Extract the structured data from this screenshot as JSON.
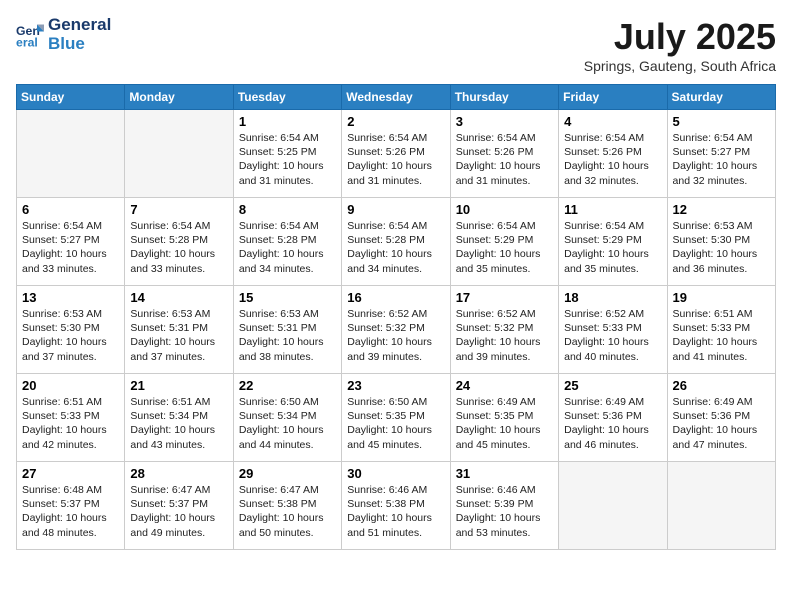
{
  "header": {
    "logo_line1": "General",
    "logo_line2": "Blue",
    "month_year": "July 2025",
    "location": "Springs, Gauteng, South Africa"
  },
  "days_of_week": [
    "Sunday",
    "Monday",
    "Tuesday",
    "Wednesday",
    "Thursday",
    "Friday",
    "Saturday"
  ],
  "weeks": [
    [
      {
        "day": "",
        "empty": true
      },
      {
        "day": "",
        "empty": true
      },
      {
        "day": "1",
        "sunrise": "6:54 AM",
        "sunset": "5:25 PM",
        "daylight": "10 hours and 31 minutes."
      },
      {
        "day": "2",
        "sunrise": "6:54 AM",
        "sunset": "5:26 PM",
        "daylight": "10 hours and 31 minutes."
      },
      {
        "day": "3",
        "sunrise": "6:54 AM",
        "sunset": "5:26 PM",
        "daylight": "10 hours and 31 minutes."
      },
      {
        "day": "4",
        "sunrise": "6:54 AM",
        "sunset": "5:26 PM",
        "daylight": "10 hours and 32 minutes."
      },
      {
        "day": "5",
        "sunrise": "6:54 AM",
        "sunset": "5:27 PM",
        "daylight": "10 hours and 32 minutes."
      }
    ],
    [
      {
        "day": "6",
        "sunrise": "6:54 AM",
        "sunset": "5:27 PM",
        "daylight": "10 hours and 33 minutes."
      },
      {
        "day": "7",
        "sunrise": "6:54 AM",
        "sunset": "5:28 PM",
        "daylight": "10 hours and 33 minutes."
      },
      {
        "day": "8",
        "sunrise": "6:54 AM",
        "sunset": "5:28 PM",
        "daylight": "10 hours and 34 minutes."
      },
      {
        "day": "9",
        "sunrise": "6:54 AM",
        "sunset": "5:28 PM",
        "daylight": "10 hours and 34 minutes."
      },
      {
        "day": "10",
        "sunrise": "6:54 AM",
        "sunset": "5:29 PM",
        "daylight": "10 hours and 35 minutes."
      },
      {
        "day": "11",
        "sunrise": "6:54 AM",
        "sunset": "5:29 PM",
        "daylight": "10 hours and 35 minutes."
      },
      {
        "day": "12",
        "sunrise": "6:53 AM",
        "sunset": "5:30 PM",
        "daylight": "10 hours and 36 minutes."
      }
    ],
    [
      {
        "day": "13",
        "sunrise": "6:53 AM",
        "sunset": "5:30 PM",
        "daylight": "10 hours and 37 minutes."
      },
      {
        "day": "14",
        "sunrise": "6:53 AM",
        "sunset": "5:31 PM",
        "daylight": "10 hours and 37 minutes."
      },
      {
        "day": "15",
        "sunrise": "6:53 AM",
        "sunset": "5:31 PM",
        "daylight": "10 hours and 38 minutes."
      },
      {
        "day": "16",
        "sunrise": "6:52 AM",
        "sunset": "5:32 PM",
        "daylight": "10 hours and 39 minutes."
      },
      {
        "day": "17",
        "sunrise": "6:52 AM",
        "sunset": "5:32 PM",
        "daylight": "10 hours and 39 minutes."
      },
      {
        "day": "18",
        "sunrise": "6:52 AM",
        "sunset": "5:33 PM",
        "daylight": "10 hours and 40 minutes."
      },
      {
        "day": "19",
        "sunrise": "6:51 AM",
        "sunset": "5:33 PM",
        "daylight": "10 hours and 41 minutes."
      }
    ],
    [
      {
        "day": "20",
        "sunrise": "6:51 AM",
        "sunset": "5:33 PM",
        "daylight": "10 hours and 42 minutes."
      },
      {
        "day": "21",
        "sunrise": "6:51 AM",
        "sunset": "5:34 PM",
        "daylight": "10 hours and 43 minutes."
      },
      {
        "day": "22",
        "sunrise": "6:50 AM",
        "sunset": "5:34 PM",
        "daylight": "10 hours and 44 minutes."
      },
      {
        "day": "23",
        "sunrise": "6:50 AM",
        "sunset": "5:35 PM",
        "daylight": "10 hours and 45 minutes."
      },
      {
        "day": "24",
        "sunrise": "6:49 AM",
        "sunset": "5:35 PM",
        "daylight": "10 hours and 45 minutes."
      },
      {
        "day": "25",
        "sunrise": "6:49 AM",
        "sunset": "5:36 PM",
        "daylight": "10 hours and 46 minutes."
      },
      {
        "day": "26",
        "sunrise": "6:49 AM",
        "sunset": "5:36 PM",
        "daylight": "10 hours and 47 minutes."
      }
    ],
    [
      {
        "day": "27",
        "sunrise": "6:48 AM",
        "sunset": "5:37 PM",
        "daylight": "10 hours and 48 minutes."
      },
      {
        "day": "28",
        "sunrise": "6:47 AM",
        "sunset": "5:37 PM",
        "daylight": "10 hours and 49 minutes."
      },
      {
        "day": "29",
        "sunrise": "6:47 AM",
        "sunset": "5:38 PM",
        "daylight": "10 hours and 50 minutes."
      },
      {
        "day": "30",
        "sunrise": "6:46 AM",
        "sunset": "5:38 PM",
        "daylight": "10 hours and 51 minutes."
      },
      {
        "day": "31",
        "sunrise": "6:46 AM",
        "sunset": "5:39 PM",
        "daylight": "10 hours and 53 minutes."
      },
      {
        "day": "",
        "empty": true
      },
      {
        "day": "",
        "empty": true
      }
    ]
  ],
  "labels": {
    "sunrise_prefix": "Sunrise: ",
    "sunset_prefix": "Sunset: ",
    "daylight_label": "Daylight: "
  }
}
